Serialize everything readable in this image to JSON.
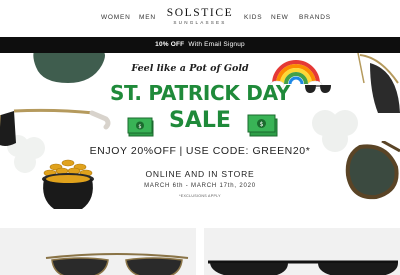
{
  "header": {
    "nav_left": [
      "WOMEN",
      "MEN"
    ],
    "logo_main": "SOLSTICE",
    "logo_sub": "SUNGLASSES",
    "nav_right": [
      "KIDS",
      "NEW",
      "BRANDS"
    ]
  },
  "promo_bar": {
    "highlight": "10% OFF",
    "text": "With Email Signup"
  },
  "hero": {
    "tagline": "Feel like a Pot of Gold",
    "title_line1": "ST. PATRICK DAY",
    "title_line2": "SALE",
    "offer_main": "ENJOY 20%OFF",
    "offer_separator": "|",
    "offer_code": "USE CODE: GREEN20*",
    "availability": "ONLINE AND IN STORE",
    "dates": "MARCH 6th - MARCH 17th, 2020",
    "exclusions": "*EXCLUSIONS APPLY"
  },
  "colors": {
    "brand_green": "#1f8a3a",
    "promo_bar_bg": "#0e0e0e",
    "gold": "#e0a21c"
  }
}
